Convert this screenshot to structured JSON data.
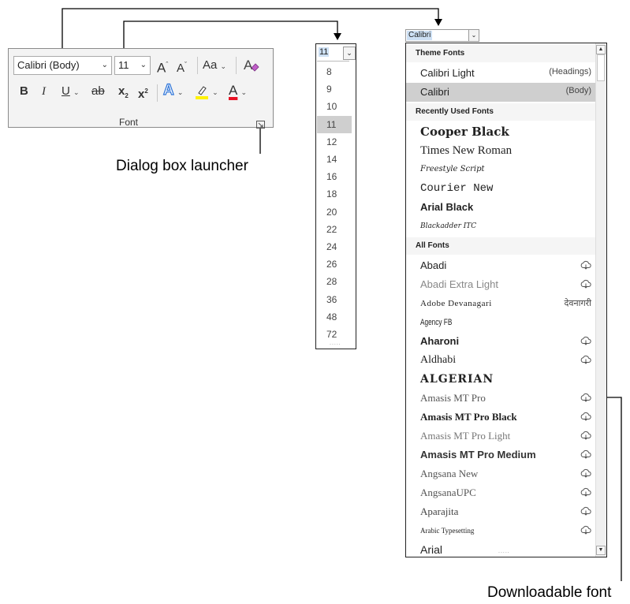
{
  "font_group": {
    "font_name": "Calibri (Body)",
    "font_size": "11",
    "grow_label": "A",
    "shrink_label": "A",
    "change_case_label": "Aa",
    "bold": "B",
    "italic": "I",
    "underline": "U",
    "strike": "ab",
    "subscript": "x",
    "subscript_mark": "2",
    "superscript": "x",
    "superscript_mark": "2",
    "text_effects": "A",
    "font_color": "A",
    "group_label": "Font",
    "font_color_hex": "#e81123",
    "highlight_hex": "#fff200",
    "effects_hex": "#2e75d9"
  },
  "size_list": {
    "current": "11",
    "sizes": [
      "8",
      "9",
      "10",
      "11",
      "12",
      "14",
      "16",
      "18",
      "20",
      "22",
      "24",
      "26",
      "28",
      "36",
      "48",
      "72"
    ],
    "selected": "11"
  },
  "font_list": {
    "current": "Calibri",
    "theme_header": "Theme Fonts",
    "theme": [
      {
        "name": "Calibri Light",
        "tag": "(Headings)"
      },
      {
        "name": "Calibri",
        "tag": "(Body)"
      }
    ],
    "recent_header": "Recently Used Fonts",
    "recent": [
      "Cooper Black",
      "Times New Roman",
      "Freestyle Script",
      "Courier New",
      "Arial Black",
      "Blackadder ITC"
    ],
    "all_header": "All Fonts",
    "all": [
      {
        "name": "Abadi",
        "tag": "cloud"
      },
      {
        "name": "Abadi Extra Light",
        "tag": "cloud"
      },
      {
        "name": "Adobe Devanagari",
        "tag": "देवनागरी"
      },
      {
        "name": "Agency FB",
        "tag": ""
      },
      {
        "name": "Aharoni",
        "tag": "cloud"
      },
      {
        "name": "Aldhabi",
        "tag": "cloud"
      },
      {
        "name": "ALGERIAN",
        "tag": ""
      },
      {
        "name": "Amasis MT Pro",
        "tag": "cloud"
      },
      {
        "name": "Amasis MT Pro Black",
        "tag": "cloud"
      },
      {
        "name": "Amasis MT Pro Light",
        "tag": "cloud"
      },
      {
        "name": "Amasis MT Pro Medium",
        "tag": "cloud"
      },
      {
        "name": "Angsana New",
        "tag": "cloud"
      },
      {
        "name": "AngsanaUPC",
        "tag": "cloud"
      },
      {
        "name": "Aparajita",
        "tag": "cloud"
      },
      {
        "name": "Arabic Typesetting",
        "tag": "cloud"
      },
      {
        "name": "Arial",
        "tag": ""
      }
    ]
  },
  "captions": {
    "dialog": "Dialog box launcher",
    "downloadable": "Downloadable font"
  }
}
